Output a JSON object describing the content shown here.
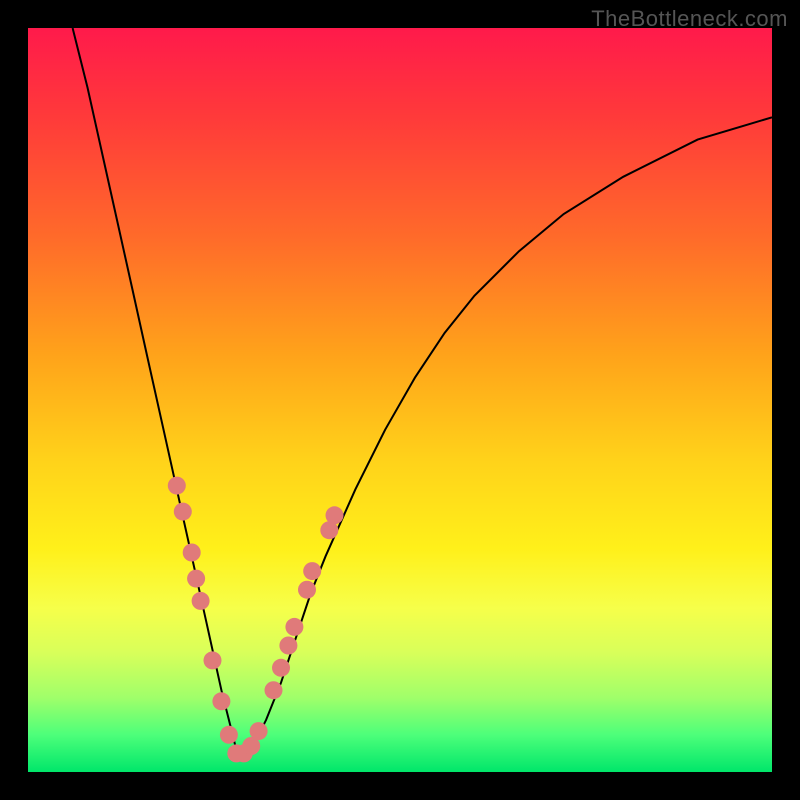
{
  "watermark": "TheBottleneck.com",
  "colors": {
    "frame_bg": "#000000",
    "marker": "#e07a7a",
    "curve_stroke": "#000000",
    "gradient": [
      "#ff1a4b",
      "#ff3a3a",
      "#ff6a2a",
      "#ffa31a",
      "#ffd21a",
      "#fff01a",
      "#f6ff4a",
      "#d8ff5a",
      "#a0ff6a",
      "#4dff7a",
      "#00e66a"
    ]
  },
  "chart_data": {
    "type": "line",
    "title": "",
    "xlabel": "",
    "ylabel": "",
    "x_range": [
      0,
      100
    ],
    "y_range": [
      0,
      100
    ],
    "grid": false,
    "legend": false,
    "series": [
      {
        "name": "bottleneck-curve",
        "description": "V-shaped curve descending steeply from upper-left, reaching a minimum near x≈28, then rising with diminishing slope toward the right edge.",
        "x": [
          6,
          8,
          10,
          12,
          14,
          16,
          18,
          20,
          22,
          24,
          26,
          27,
          28,
          29,
          30,
          32,
          34,
          36,
          38,
          40,
          44,
          48,
          52,
          56,
          60,
          66,
          72,
          80,
          90,
          100
        ],
        "y": [
          100,
          92,
          83,
          74,
          65,
          56,
          47,
          38,
          29,
          20,
          11,
          7,
          3,
          2,
          3,
          7,
          12,
          18,
          24,
          29,
          38,
          46,
          53,
          59,
          64,
          70,
          75,
          80,
          85,
          88
        ]
      }
    ],
    "markers": {
      "description": "Pink/salmon dot markers clustered on both arms of the curve near the trough.",
      "points": [
        {
          "x": 20.0,
          "y": 38.5
        },
        {
          "x": 20.8,
          "y": 35.0
        },
        {
          "x": 22.0,
          "y": 29.5
        },
        {
          "x": 22.6,
          "y": 26.0
        },
        {
          "x": 23.2,
          "y": 23.0
        },
        {
          "x": 24.8,
          "y": 15.0
        },
        {
          "x": 26.0,
          "y": 9.5
        },
        {
          "x": 27.0,
          "y": 5.0
        },
        {
          "x": 28.0,
          "y": 2.5
        },
        {
          "x": 29.0,
          "y": 2.5
        },
        {
          "x": 30.0,
          "y": 3.5
        },
        {
          "x": 31.0,
          "y": 5.5
        },
        {
          "x": 33.0,
          "y": 11.0
        },
        {
          "x": 34.0,
          "y": 14.0
        },
        {
          "x": 35.0,
          "y": 17.0
        },
        {
          "x": 35.8,
          "y": 19.5
        },
        {
          "x": 37.5,
          "y": 24.5
        },
        {
          "x": 38.2,
          "y": 27.0
        },
        {
          "x": 40.5,
          "y": 32.5
        },
        {
          "x": 41.2,
          "y": 34.5
        }
      ]
    }
  }
}
